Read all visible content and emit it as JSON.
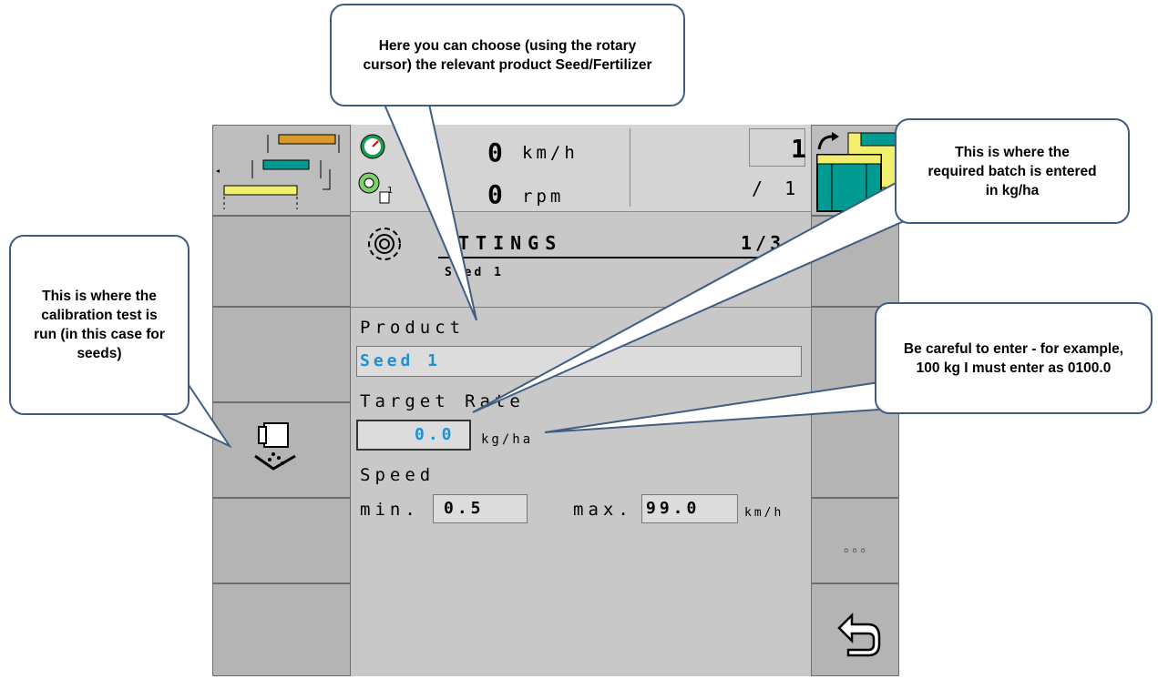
{
  "header": {
    "speed_value": "0",
    "speed_unit": "km/h",
    "rpm_value": "0",
    "rpm_unit": "rpm",
    "counter_value": "1",
    "counter_total": "/ 1",
    "rpm_icon_badge": "1"
  },
  "page": {
    "title": "TTINGS",
    "page_indicator": "1/3",
    "subtitle_prefix": "S",
    "subtitle_rest": "ed 1"
  },
  "form": {
    "product_label": "Product",
    "product_value": "Seed 1",
    "target_rate_label": "Target Rate",
    "target_rate_value": "0.0",
    "target_rate_unit": "kg/ha",
    "speed_label": "Speed",
    "min_label": "min.",
    "min_value": "0.5",
    "max_label": "max.",
    "max_value": "99.0",
    "speed_unit": "km/h"
  },
  "softkeys": {
    "more_label": "◦◦◦"
  },
  "callouts": {
    "product_hint": "Here you can choose (using the rotary cursor) the relevant product Seed/Fertilizer",
    "batch_hint": "This is where the required batch is entered in kg/ha",
    "calibration_hint": "This is where the calibration test is run (in this case for seeds)",
    "format_hint": "Be careful to enter - for example, 100 kg I must enter as 0100.0"
  },
  "colors": {
    "value_blue": "#1e90d6",
    "callout_border": "#3f5d80",
    "teal": "#009a90",
    "yellow": "#f2ee6e",
    "orange": "#d99a2b"
  }
}
